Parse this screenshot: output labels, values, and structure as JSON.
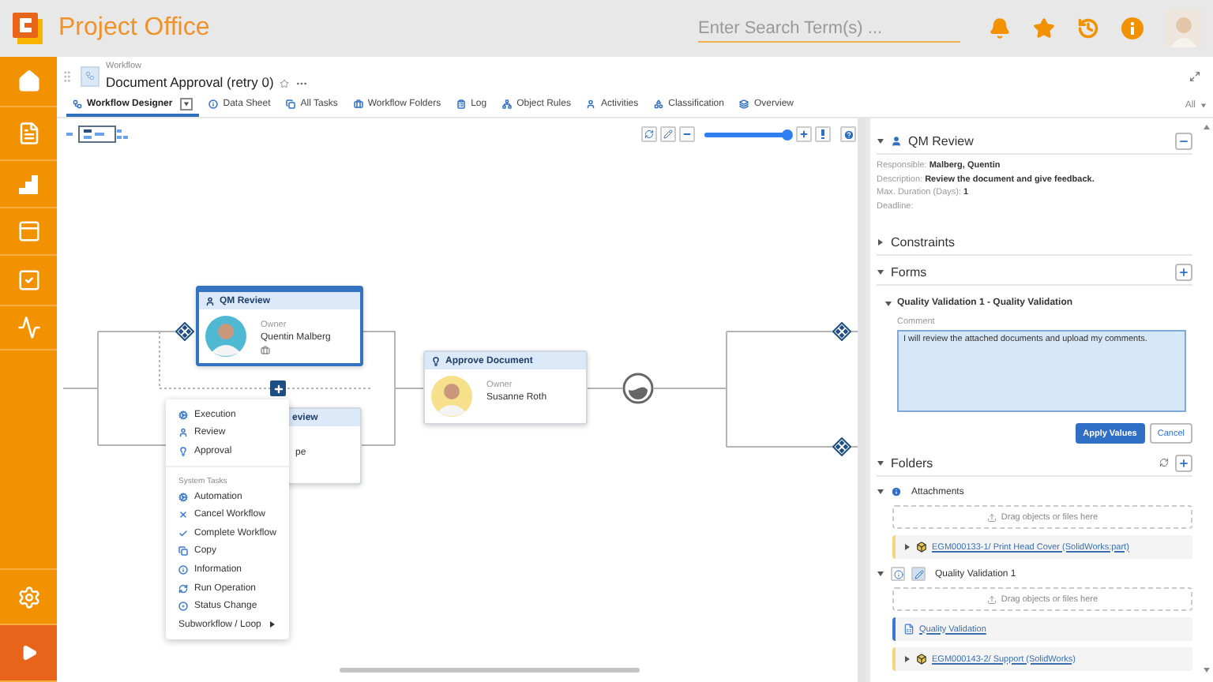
{
  "app": {
    "title": "Project Office"
  },
  "search": {
    "placeholder": "Enter Search Term(s) ..."
  },
  "breadcrumb": {
    "label": "Workflow",
    "title": "Document Approval (retry 0)"
  },
  "tabs": [
    {
      "label": "Workflow Designer",
      "selected": true,
      "has_menu": true
    },
    {
      "label": "Data Sheet",
      "selected": false,
      "has_menu": false
    },
    {
      "label": "All Tasks",
      "selected": false,
      "has_menu": false
    },
    {
      "label": "Workflow Folders",
      "selected": false,
      "has_menu": false
    },
    {
      "label": "Log",
      "selected": false,
      "has_menu": false
    },
    {
      "label": "Object Rules",
      "selected": false,
      "has_menu": false
    },
    {
      "label": "Activities",
      "selected": false,
      "has_menu": false
    },
    {
      "label": "Classification",
      "selected": false,
      "has_menu": false
    },
    {
      "label": "Overview",
      "selected": false,
      "has_menu": false
    }
  ],
  "tab_filter": {
    "label": "All"
  },
  "diagram": {
    "zoom": {
      "level": 1
    },
    "nodes": [
      {
        "kind": "task",
        "title": "QM Review",
        "owner_label": "Owner",
        "owner": "Quentin Malberg",
        "selected": true
      },
      {
        "kind": "partial",
        "title": "eview",
        "line": "pe"
      },
      {
        "kind": "task",
        "title": "Approve Document",
        "owner_label": "Owner",
        "owner": "Susanne Roth",
        "selected": false
      }
    ],
    "add_menu": {
      "task_items": [
        "Execution",
        "Review",
        "Approval"
      ],
      "section_title": "System Tasks",
      "system_items": [
        "Automation",
        "Cancel Workflow",
        "Complete Workflow",
        "Copy",
        "Information",
        "Run Operation",
        "Status Change"
      ],
      "submenu_item": "Subworkflow / Loop"
    }
  },
  "panel": {
    "task": {
      "title": "QM Review",
      "expanded": true,
      "fields": [
        {
          "label": "Responsible:",
          "value": "Malberg, Quentin"
        },
        {
          "label": "Description:",
          "value": "Review the document and give feedback."
        },
        {
          "label": "Max. Duration (Days):",
          "value": "1"
        },
        {
          "label": "Deadline:"
        }
      ]
    },
    "constraints": {
      "title": "Constraints",
      "expanded": false
    },
    "forms": {
      "title": "Forms",
      "expanded": true,
      "items": [
        {
          "title": "Quality Validation 1 - Quality Validation",
          "expanded": true,
          "field_label": "Comment",
          "value": "I will review the attached documents and upload my comments."
        }
      ],
      "buttons": [
        {
          "label": "Apply Values",
          "kind": "primary"
        },
        {
          "label": "Cancel",
          "kind": "secondary"
        }
      ]
    },
    "folders": {
      "title": "Folders",
      "expanded": true,
      "children": [
        {
          "kind": "folder",
          "label": "Attachments",
          "expanded": true,
          "drop_hint": "Drag objects or files here",
          "children": [
            {
              "kind": "document",
              "label": "EGM000133-1/ Print Head Cover (SolidWorks:part)",
              "expanded": false,
              "color": "#f3d57a"
            }
          ]
        },
        {
          "kind": "form_folder",
          "label": "Quality Validation 1",
          "expanded": true,
          "drop_hint": "Drag objects or files here",
          "children": [
            {
              "kind": "form",
              "label": "Quality Validation",
              "color": "#3b78d0"
            },
            {
              "kind": "document",
              "label": "EGM000143-2/ Support (SolidWorks)",
              "expanded": false,
              "color": "#f3d57a"
            }
          ]
        }
      ]
    }
  }
}
